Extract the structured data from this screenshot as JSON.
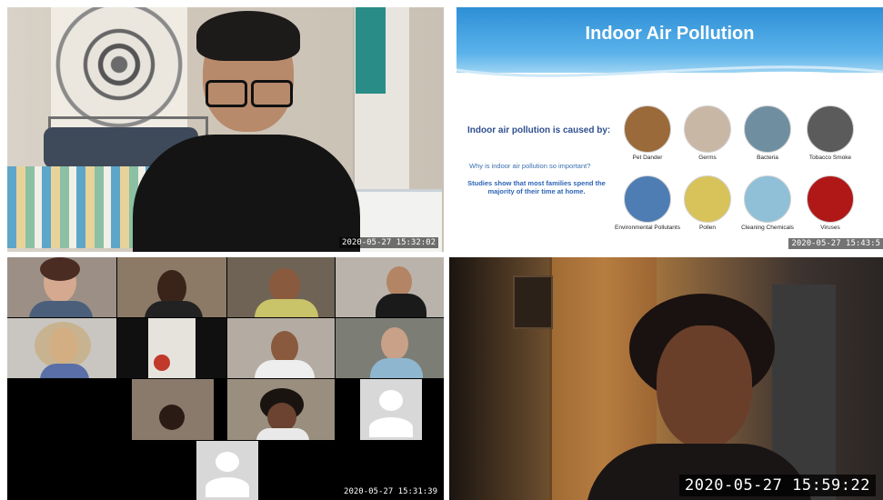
{
  "panels": {
    "top_left": {
      "timestamp": "2020-05-27 15:32:02"
    },
    "slide": {
      "title": "Indoor Air Pollution",
      "caused_by": "Indoor air pollution is caused by:",
      "why": "Why is indoor air pollution so important?",
      "studies": "Studies show that most families spend the majority of their time at home.",
      "items": [
        {
          "label": "Pet Dander",
          "color": "#9a6a3a"
        },
        {
          "label": "Germs",
          "color": "#c9b7a6"
        },
        {
          "label": "Bacteria",
          "color": "#6f8fa0"
        },
        {
          "label": "Tobacco Smoke",
          "color": "#5b5b5b"
        },
        {
          "label": "Environmental Pollutants",
          "color": "#4d7db3"
        },
        {
          "label": "Pollen",
          "color": "#d8c35a"
        },
        {
          "label": "Cleaning Chemicals",
          "color": "#8fc0d8"
        },
        {
          "label": "Viruses",
          "color": "#b01818"
        }
      ],
      "timestamp": "2020-05-27 15:43:5"
    },
    "gallery": {
      "timestamp": "2020-05-27 15:31:39"
    },
    "speaker": {
      "timestamp": "2020-05-27 15:59:22"
    }
  },
  "colors": {
    "background": "#ffffff",
    "slide_banner": "#2e8fd6",
    "slide_heading": "#2f4f8f"
  }
}
